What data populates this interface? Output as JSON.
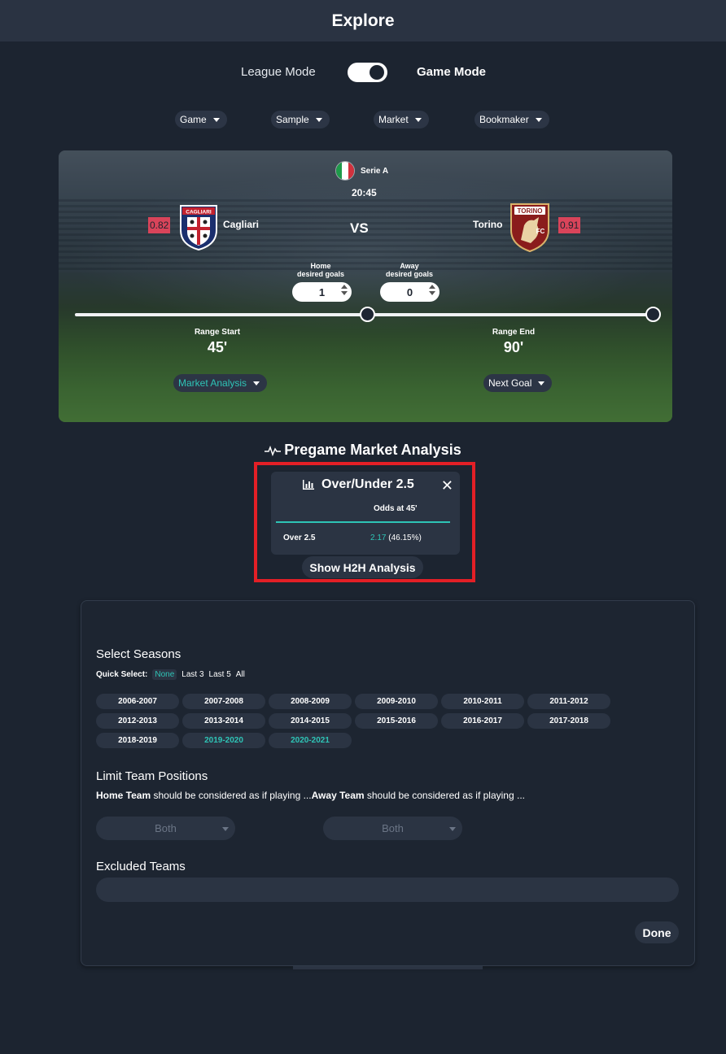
{
  "header": {
    "title": "Explore"
  },
  "mode": {
    "left_label": "League Mode",
    "right_label": "Game Mode",
    "toggle_on": true
  },
  "filters": [
    {
      "label": "Game"
    },
    {
      "label": "Sample"
    },
    {
      "label": "Market"
    },
    {
      "label": "Bookmaker"
    }
  ],
  "match": {
    "league": "Serie A",
    "kickoff": "20:45",
    "vs": "VS",
    "home": {
      "name": "Cagliari",
      "odds_badge": "0.82",
      "crest_text": "CAGLIARI"
    },
    "away": {
      "name": "Torino",
      "odds_badge": "0.91",
      "crest_text": "TORINO",
      "crest_sub": "FC"
    },
    "home_goals_label_1": "Home",
    "home_goals_label_2": "desired goals",
    "away_goals_label_1": "Away",
    "away_goals_label_2": "desired goals",
    "home_goals_value": "1",
    "away_goals_value": "0",
    "range_start_label": "Range Start",
    "range_start_value": "45'",
    "range_end_label": "Range End",
    "range_end_value": "90'",
    "left_dropdown": "Market Analysis",
    "right_dropdown": "Next Goal"
  },
  "analysis": {
    "title": "Pregame Market Analysis",
    "card": {
      "title": "Over/Under 2.5",
      "column": "Odds at 45'",
      "row_label": "Over 2.5",
      "odds": "2.17",
      "pct": "(46.15%)"
    },
    "h2h_button": "Show H2H Analysis"
  },
  "panel": {
    "seasons_heading": "Select Seasons",
    "quick_select_label": "Quick Select:",
    "quick_options": [
      "None",
      "Last 3",
      "Last 5",
      "All"
    ],
    "seasons": [
      {
        "label": "2006-2007",
        "selected": false
      },
      {
        "label": "2007-2008",
        "selected": false
      },
      {
        "label": "2008-2009",
        "selected": false
      },
      {
        "label": "2009-2010",
        "selected": false
      },
      {
        "label": "2010-2011",
        "selected": false
      },
      {
        "label": "2011-2012",
        "selected": false
      },
      {
        "label": "2012-2013",
        "selected": false
      },
      {
        "label": "2013-2014",
        "selected": false
      },
      {
        "label": "2014-2015",
        "selected": false
      },
      {
        "label": "2015-2016",
        "selected": false
      },
      {
        "label": "2016-2017",
        "selected": false
      },
      {
        "label": "2017-2018",
        "selected": false
      },
      {
        "label": "2018-2019",
        "selected": false
      },
      {
        "label": "2019-2020",
        "selected": true
      },
      {
        "label": "2020-2021",
        "selected": true
      }
    ],
    "limit_heading": "Limit Team Positions",
    "limit_home_bold": "Home Team",
    "limit_home_text": " should be considered as if playing ...",
    "limit_away_bold": "Away Team",
    "limit_away_text": " should be considered as if playing ...",
    "home_position": "Both",
    "away_position": "Both",
    "excluded_heading": "Excluded Teams",
    "excluded_value": "",
    "done_label": "Done"
  },
  "colors": {
    "background": "#1c2430",
    "accent": "#2ec4b6",
    "odds_badge": "#d9445a",
    "highlight": "#e31f26"
  }
}
